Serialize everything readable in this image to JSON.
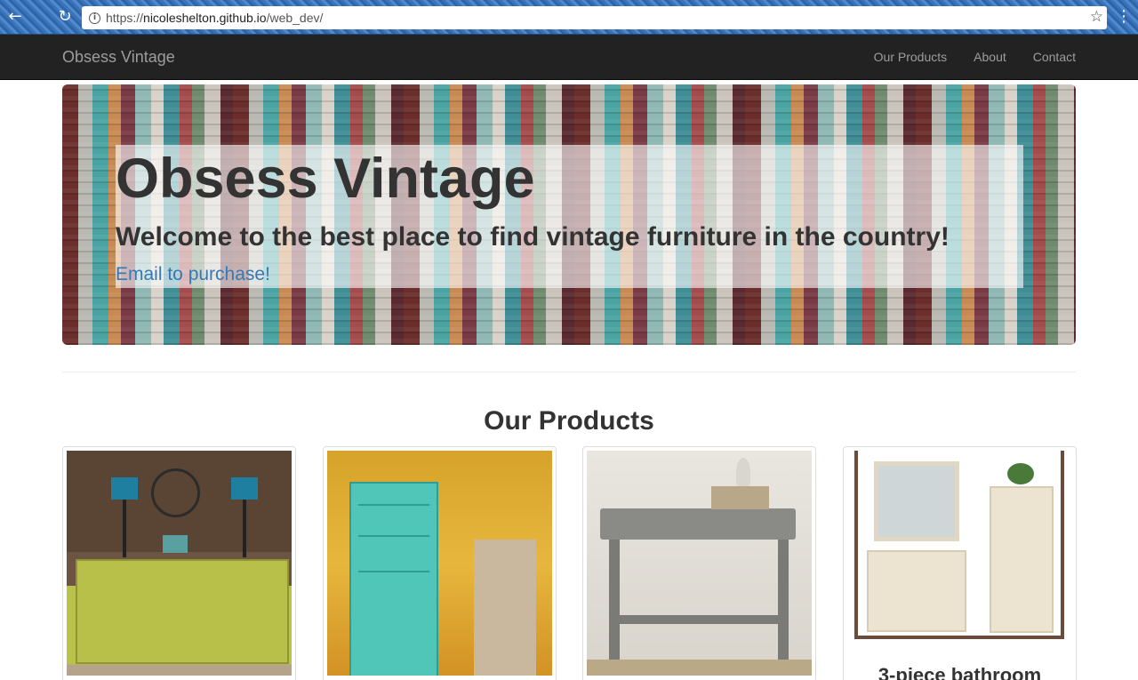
{
  "browser": {
    "url_prefix": "https://",
    "url_host": "nicoleshelton.github.io",
    "url_path": "/web_dev/"
  },
  "navbar": {
    "brand": "Obsess Vintage",
    "links": [
      "Our Products",
      "About",
      "Contact"
    ]
  },
  "hero": {
    "title": "Obsess Vintage",
    "subtitle": "Welcome to the best place to find vintage furniture in the country!",
    "link": "Email to purchase!"
  },
  "products": {
    "heading": "Our Products",
    "items": [
      {
        "image": "dresser-photo",
        "title": ""
      },
      {
        "image": "hutch-photo",
        "title": ""
      },
      {
        "image": "console-photo",
        "title": ""
      },
      {
        "image": "bathroom-set-photo",
        "title": "3-piece bathroom"
      }
    ]
  },
  "colors": {
    "navbar_bg": "#222222",
    "link_blue": "#337ab7",
    "nav_text": "#9d9d9d"
  }
}
